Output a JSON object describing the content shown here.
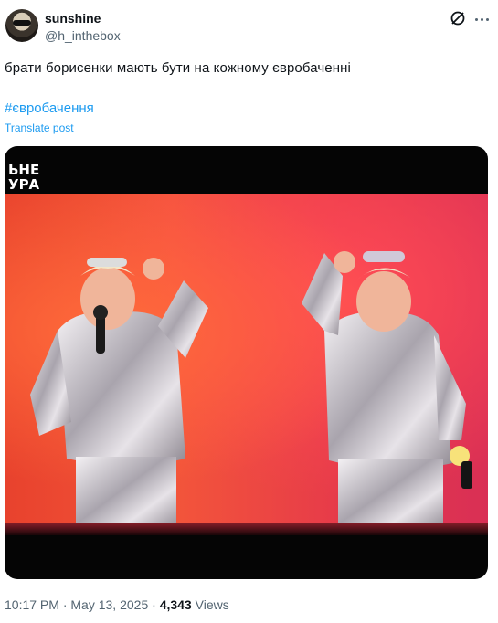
{
  "author": {
    "name": "sunshine",
    "handle": "@h_inthebox"
  },
  "post": {
    "text": "брати борисенки мають бути на кожному євробаченні",
    "hashtag": "#євробачення",
    "translate_label": "Translate post"
  },
  "media": {
    "overlay_text": "ЬНЕ\nУРА"
  },
  "meta": {
    "time": "10:17 PM",
    "date": "May 13, 2025",
    "separator": "·",
    "views_count": "4,343",
    "views_label": "Views"
  },
  "icons": [
    "grok-icon",
    "more-icon"
  ],
  "colors": {
    "link": "#1d9bf0",
    "secondary_text": "#536471",
    "primary_text": "#0f1419",
    "stage_red": "#e8422d"
  }
}
